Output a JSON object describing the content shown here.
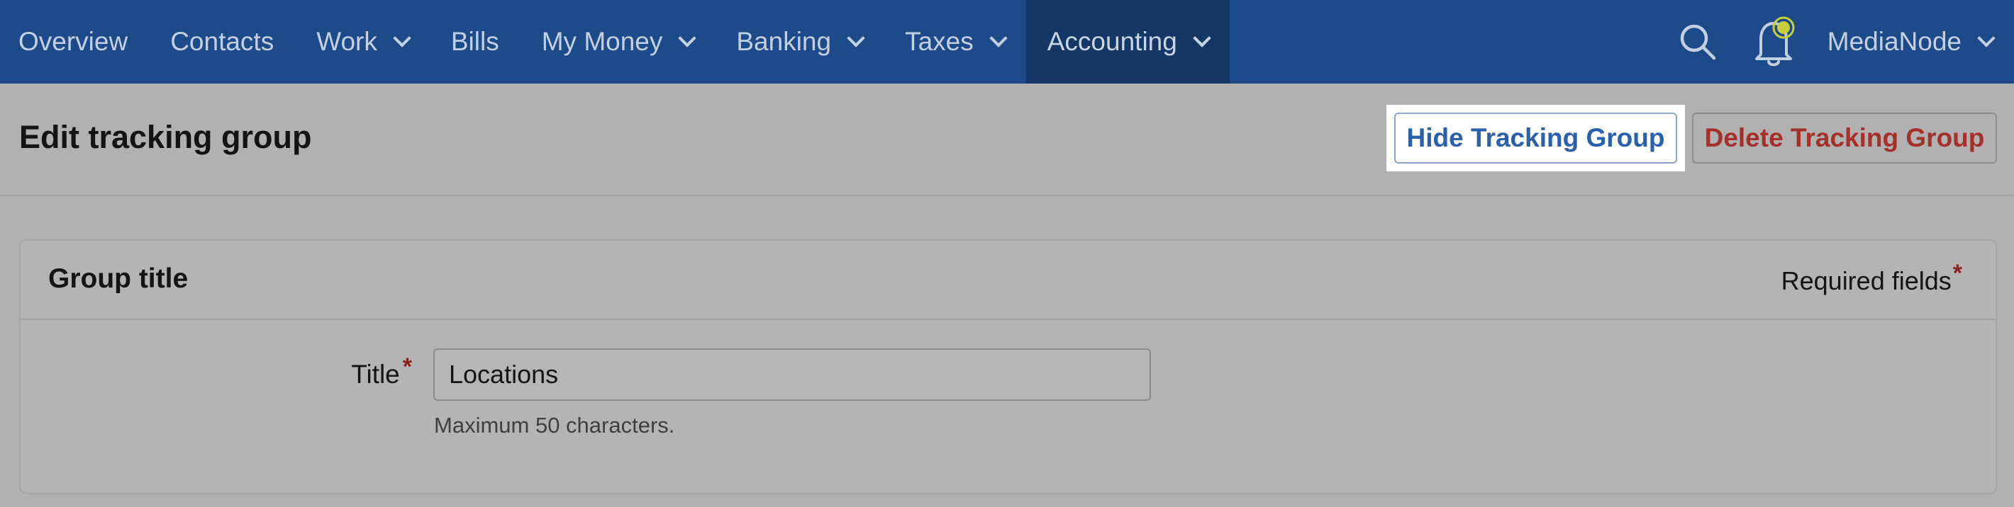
{
  "nav": {
    "items": [
      {
        "label": "Overview",
        "dropdown": false,
        "active": false
      },
      {
        "label": "Contacts",
        "dropdown": false,
        "active": false
      },
      {
        "label": "Work",
        "dropdown": true,
        "active": false
      },
      {
        "label": "Bills",
        "dropdown": false,
        "active": false
      },
      {
        "label": "My Money",
        "dropdown": true,
        "active": false
      },
      {
        "label": "Banking",
        "dropdown": true,
        "active": false
      },
      {
        "label": "Taxes",
        "dropdown": true,
        "active": false
      },
      {
        "label": "Accounting",
        "dropdown": true,
        "active": true
      }
    ],
    "search_icon": "search-icon",
    "notification_icon": "bell-icon",
    "user_menu_label": "MediaNode"
  },
  "page": {
    "title": "Edit tracking group",
    "hide_button_label": "Hide Tracking Group",
    "delete_button_label": "Delete Tracking Group"
  },
  "form": {
    "section_title": "Group title",
    "required_note": "Required fields",
    "required_marker": "*",
    "title_field": {
      "label": "Title",
      "value": "Locations",
      "help": "Maximum 50 characters."
    }
  },
  "colors": {
    "nav_bg": "#1d4b8a",
    "nav_active_bg": "#153766",
    "hide_button_text": "#2960ad",
    "delete_button_text": "#a5302a",
    "required_marker": "#8e1f1a",
    "notification_dot": "#c8cf3a"
  }
}
